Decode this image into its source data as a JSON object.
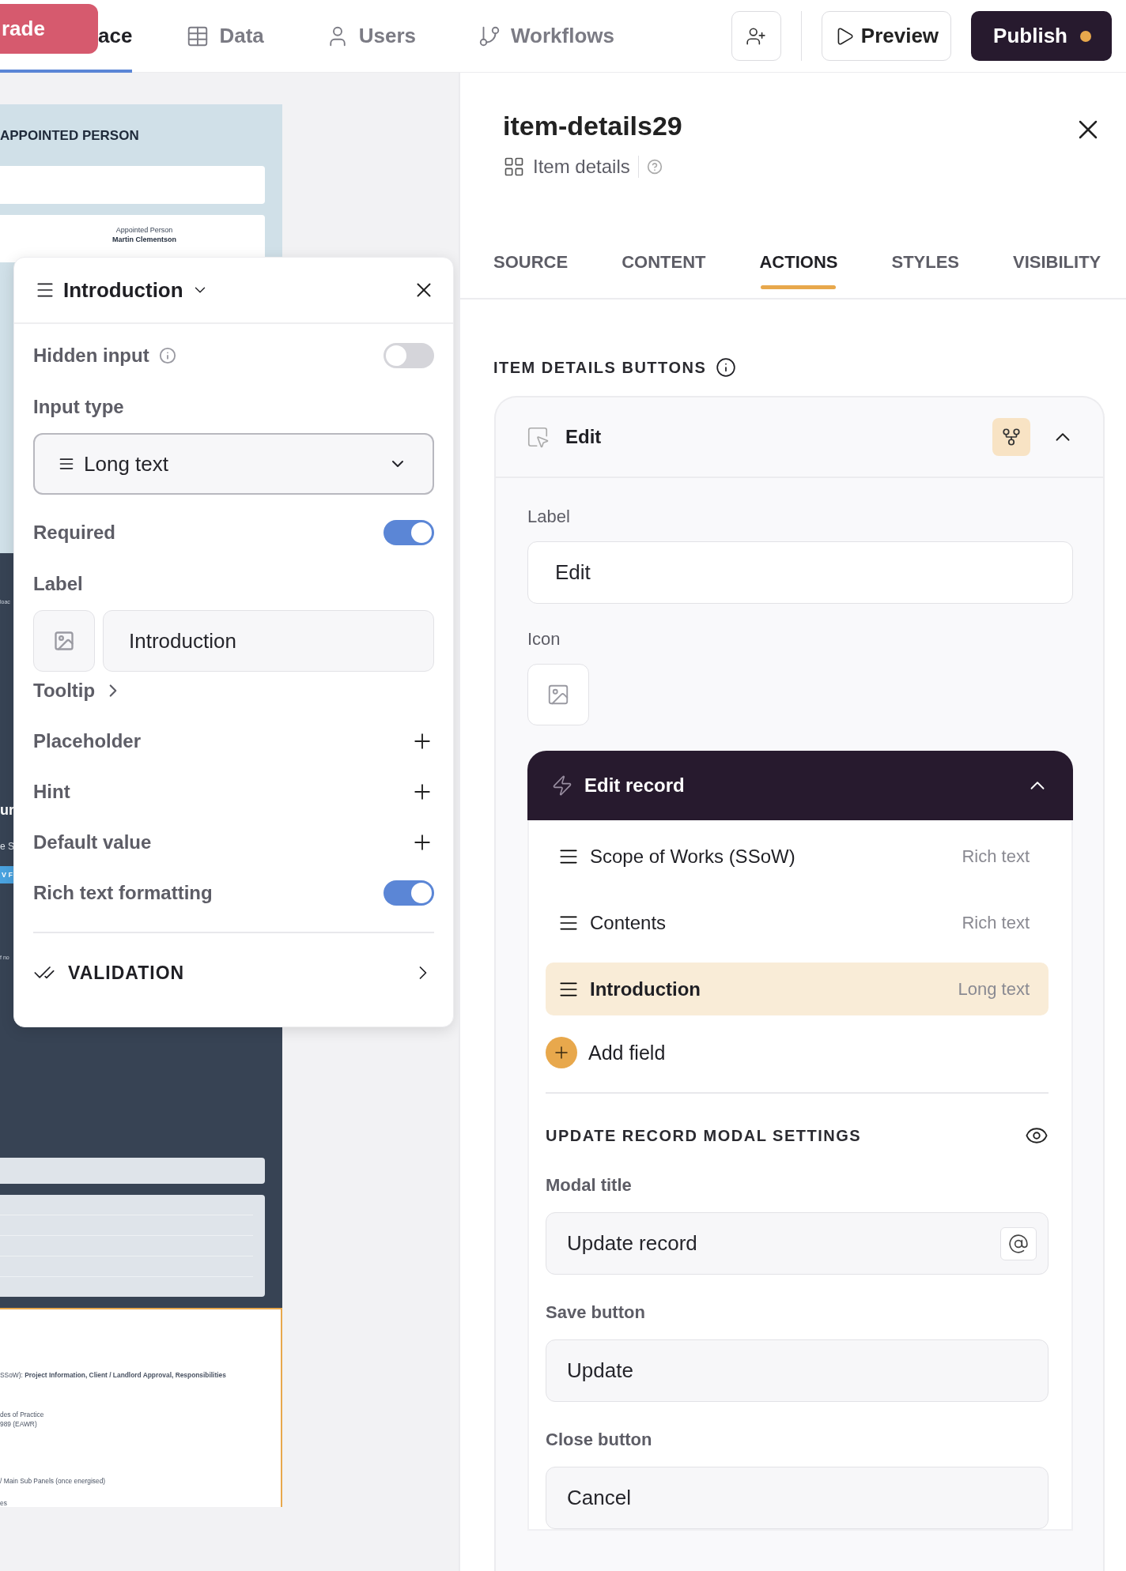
{
  "top_bar": {
    "upgrade_button": "rade",
    "nav_tabs": [
      {
        "label": "ace",
        "selected": true
      },
      {
        "label": "Data",
        "selected": false
      },
      {
        "label": "Users",
        "selected": false
      },
      {
        "label": "Workflows",
        "selected": false
      }
    ],
    "preview_button": "Preview",
    "publish_button": "Publish",
    "unpublished_changes": true
  },
  "canvas_preview": {
    "heading": "APPOINTED PERSON",
    "card_label": "Appointed Person",
    "card_value": "Martin Clementson",
    "fragments": [
      {
        "kind": "small",
        "text": "loac"
      },
      {
        "kind": "bold",
        "text": "ur"
      },
      {
        "kind": "plain",
        "text": "e S"
      },
      {
        "kind": "button",
        "text": "V F"
      },
      {
        "kind": "small",
        "text": "f no"
      }
    ],
    "lines": [
      "SSoW): **Project Information, Client / Landlord Approval, Responsibilities**",
      "des of Practice",
      "989 (EAWR)",
      "/ Main Sub Panels (once energised)",
      "es"
    ]
  },
  "field_popover": {
    "title": "Introduction",
    "rows": [
      {
        "kind": "toggle",
        "label": "Hidden input",
        "info": true,
        "on": false
      },
      {
        "kind": "select",
        "label": "Input type",
        "value": "Long text"
      },
      {
        "kind": "toggle",
        "label": "Required",
        "info": false,
        "on": true
      },
      {
        "kind": "label_input",
        "label": "Label",
        "value": "Introduction"
      },
      {
        "kind": "link",
        "label": "Tooltip"
      },
      {
        "kind": "add",
        "label": "Placeholder"
      },
      {
        "kind": "add",
        "label": "Hint"
      },
      {
        "kind": "add",
        "label": "Default value"
      },
      {
        "kind": "toggle",
        "label": "Rich text formatting",
        "info": false,
        "on": true
      }
    ],
    "validation": "VALIDATION"
  },
  "properties_panel": {
    "title": "item-details29",
    "subtitle": "Item details",
    "tabs": [
      {
        "label": "SOURCE",
        "selected": false
      },
      {
        "label": "CONTENT",
        "selected": false
      },
      {
        "label": "ACTIONS",
        "selected": true
      },
      {
        "label": "STYLES",
        "selected": false
      },
      {
        "label": "VISIBILITY",
        "selected": false
      }
    ],
    "section_title": "ITEM DETAILS BUTTONS",
    "button_card": {
      "name": "Edit",
      "expanded": true,
      "label_caption": "Label",
      "label_value": "Edit",
      "icon_caption": "Icon",
      "action": {
        "title": "Edit record",
        "expanded": true,
        "fields": [
          {
            "name": "Scope of Works (SSoW)",
            "type": "Rich text",
            "selected": false
          },
          {
            "name": "Contents",
            "type": "Rich text",
            "selected": false
          },
          {
            "name": "Introduction",
            "type": "Long text",
            "selected": true
          }
        ],
        "add_field": "Add field",
        "modal_settings": {
          "title": "UPDATE RECORD MODAL SETTINGS",
          "fields": [
            {
              "label": "Modal title",
              "value": "Update record",
              "kind": "mention"
            },
            {
              "label": "Save button",
              "value": "Update",
              "kind": "plain"
            },
            {
              "label": "Close button",
              "value": "Cancel",
              "kind": "plain"
            }
          ]
        }
      }
    }
  }
}
